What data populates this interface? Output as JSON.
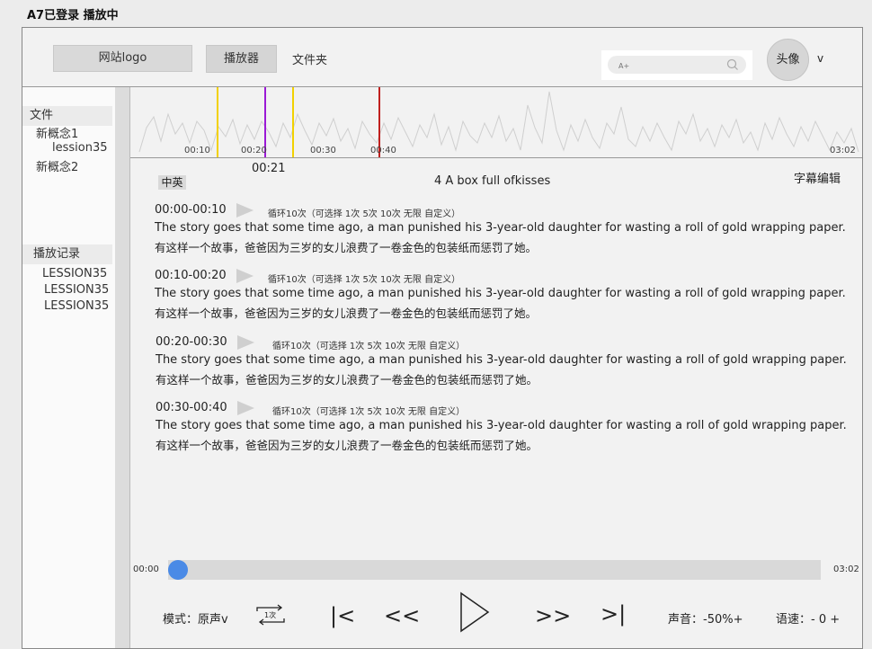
{
  "window_title": "A7已登录 播放中",
  "header": {
    "logo": "网站logo",
    "tab_player": "播放器",
    "tab_folder": "文件夹",
    "search_placeholder": "A+",
    "avatar": "头像",
    "avatar_caret": "v"
  },
  "sidebar": {
    "files_heading": "文件",
    "files": [
      {
        "label": "新概念1"
      },
      {
        "label": "lession35"
      },
      {
        "label": "新概念2"
      }
    ],
    "history_heading": "播放记录",
    "history": [
      {
        "label": "LESSION35"
      },
      {
        "label": "LESSION35"
      },
      {
        "label": "LESSION35"
      }
    ]
  },
  "waveform": {
    "ticks": [
      "00:10",
      "00:20",
      "00:30",
      "00:40"
    ],
    "end_time": "03:02",
    "marker_time": "00:21",
    "marker_colors": [
      "#f2d100",
      "#9b19d6",
      "#f2d100",
      "#c0201e"
    ]
  },
  "main": {
    "lang_toggle": "中英",
    "track_title": "4 A box full ofkisses",
    "subtitle_edit": "字幕编辑",
    "segments": [
      {
        "time": "00:00-00:10",
        "loop": "循环10次（可选择 1次 5次 10次 无限  自定义）",
        "en": "The story goes that some time ago, a man punished his 3-year-old daughter for wasting a roll of gold wrapping paper.",
        "zh": "有这样一个故事，爸爸因为三岁的女儿浪费了一卷金色的包装纸而惩罚了她。"
      },
      {
        "time": "00:10-00:20",
        "loop": "循环10次（可选择 1次 5次 10次 无限  自定义）",
        "en": "The story goes that some time ago, a man punished his 3-year-old daughter for wasting a roll of gold wrapping paper.",
        "zh": "有这样一个故事，爸爸因为三岁的女儿浪费了一卷金色的包装纸而惩罚了她。"
      },
      {
        "time": "00:20-00:30",
        "loop": "循环10次（可选择 1次 5次 10次 无限  自定义）",
        "en": "The story goes that some time ago, a man punished his 3-year-old daughter for wasting a roll of gold wrapping paper.",
        "zh": "有这样一个故事，爸爸因为三岁的女儿浪费了一卷金色的包装纸而惩罚了她。"
      },
      {
        "time": "00:30-00:40",
        "loop": "循环10次（可选择 1次 5次 10次 无限  自定义）",
        "en": "The story goes that some time ago, a man punished his 3-year-old daughter for wasting a roll of gold wrapping paper.",
        "zh": "有这样一个故事，爸爸因为三岁的女儿浪费了一卷金色的包装纸而惩罚了她。"
      }
    ]
  },
  "player": {
    "current_time": "00:00",
    "total_time": "03:02",
    "progress": 0,
    "mode": "模式：原声v",
    "repeat_label": "1次",
    "prev_track": "|<",
    "rewind": "<<",
    "forward": ">>",
    "next_track": ">|",
    "volume": "声音：-50%+",
    "speed": "语速：- 0 +",
    "accent_color": "#4a8ae6"
  }
}
